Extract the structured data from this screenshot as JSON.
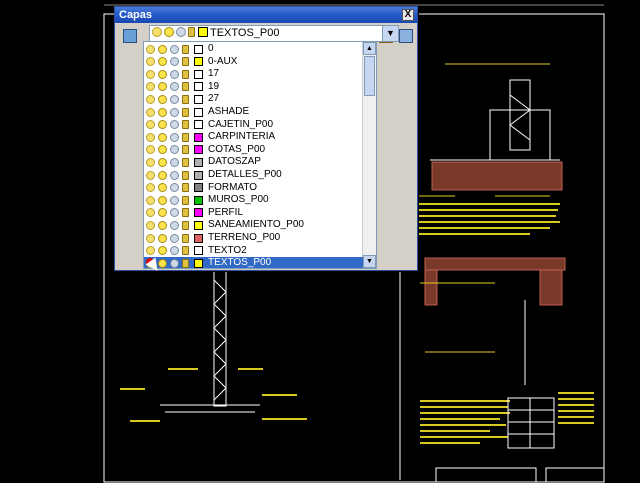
{
  "dialog": {
    "title": "Capas",
    "close_label": "X",
    "current_layer": "TEXTOS_P00",
    "current_layer_color": "#ffff00"
  },
  "layers": [
    {
      "name": "0",
      "color": "#ffffff"
    },
    {
      "name": "0-AUX",
      "color": "#ffff00"
    },
    {
      "name": "17",
      "color": "#ffffff"
    },
    {
      "name": "19",
      "color": "#ffffff"
    },
    {
      "name": "27",
      "color": "#ffffff"
    },
    {
      "name": "ASHADE",
      "color": "#ffffff"
    },
    {
      "name": "CAJETIN_P00",
      "color": "#ffffff"
    },
    {
      "name": "CARPINTERIA",
      "color": "#ff00ff"
    },
    {
      "name": "COTAS_P00",
      "color": "#ff00ff"
    },
    {
      "name": "DATOSZAP",
      "color": "#b0b0b0"
    },
    {
      "name": "DETALLES_P00",
      "color": "#b0b0b0"
    },
    {
      "name": "FORMATO",
      "color": "#808080"
    },
    {
      "name": "MUROS_P00",
      "color": "#00c000"
    },
    {
      "name": "PERFIL",
      "color": "#ff00ff"
    },
    {
      "name": "SANEAMIENTO_P00",
      "color": "#ffff00"
    },
    {
      "name": "TERRENO_P00",
      "color": "#e06060"
    },
    {
      "name": "TEXTO2",
      "color": "#ffffff"
    },
    {
      "name": "TEXTOS_P00",
      "color": "#ffff00",
      "selected": true
    }
  ],
  "icons": {
    "on": "lightbulb-icon",
    "freeze": "sun-icon",
    "viewport_freeze": "viewport-sun-icon",
    "lock": "lock-icon",
    "layer_manager": "layer-manager-icon",
    "make_current": "make-current-icon",
    "previous": "layer-previous-icon"
  }
}
